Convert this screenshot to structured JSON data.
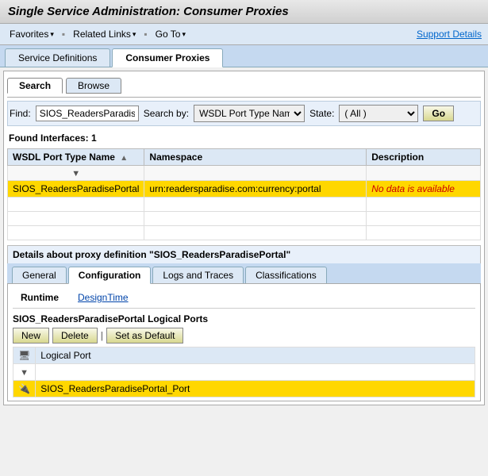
{
  "page": {
    "title": "Single Service Administration: Consumer Proxies"
  },
  "toolbar": {
    "favorites_label": "Favorites",
    "related_links_label": "Related Links",
    "goto_label": "Go To",
    "support_details_label": "Support Details",
    "arrow": "▾"
  },
  "main_tabs": [
    {
      "label": "Service Definitions",
      "active": false
    },
    {
      "label": "Consumer Proxies",
      "active": true
    }
  ],
  "sub_tabs": [
    {
      "label": "Search",
      "active": true
    },
    {
      "label": "Browse",
      "active": false
    }
  ],
  "find": {
    "find_label": "Find:",
    "find_value": "SIOS_ReadersParadise",
    "search_by_label": "Search by:",
    "search_by_value": "WSDL Port Type Nam▾",
    "state_label": "State:",
    "state_value": "( All )",
    "go_label": "Go"
  },
  "results": {
    "found_label": "Found Interfaces: 1",
    "columns": [
      "WSDL Port Type Name",
      "Namespace",
      "Description"
    ],
    "filter_icon": "▼",
    "sort_icon": "▲",
    "rows": [
      {
        "name": "SIOS_ReadersParadisePortal",
        "namespace": "urn:readersparadise.com:currency:portal",
        "description": "No data is available",
        "selected": true
      },
      {
        "name": "",
        "namespace": "",
        "description": "",
        "selected": false
      },
      {
        "name": "",
        "namespace": "",
        "description": "",
        "selected": false
      },
      {
        "name": "",
        "namespace": "",
        "description": "",
        "selected": false
      }
    ]
  },
  "details_section": {
    "header": "Details about proxy definition \"SIOS_ReadersParadisePortal\"",
    "tabs": [
      {
        "label": "General",
        "active": false
      },
      {
        "label": "Configuration",
        "active": true
      },
      {
        "label": "Logs and Traces",
        "active": false
      },
      {
        "label": "Classifications",
        "active": false
      }
    ]
  },
  "configuration": {
    "runtime_tabs": [
      {
        "label": "Runtime",
        "active": true
      },
      {
        "label": "DesignTime",
        "active": false
      }
    ],
    "logical_ports_title": "SIOS_ReadersParadisePortal Logical Ports",
    "buttons": {
      "new_label": "New",
      "delete_label": "Delete",
      "set_default_label": "Set as Default"
    },
    "ports_header": "Logical Port",
    "ports": [
      {
        "name": "SIOS_ReadersParadisePortal_Port",
        "selected": true
      }
    ]
  }
}
